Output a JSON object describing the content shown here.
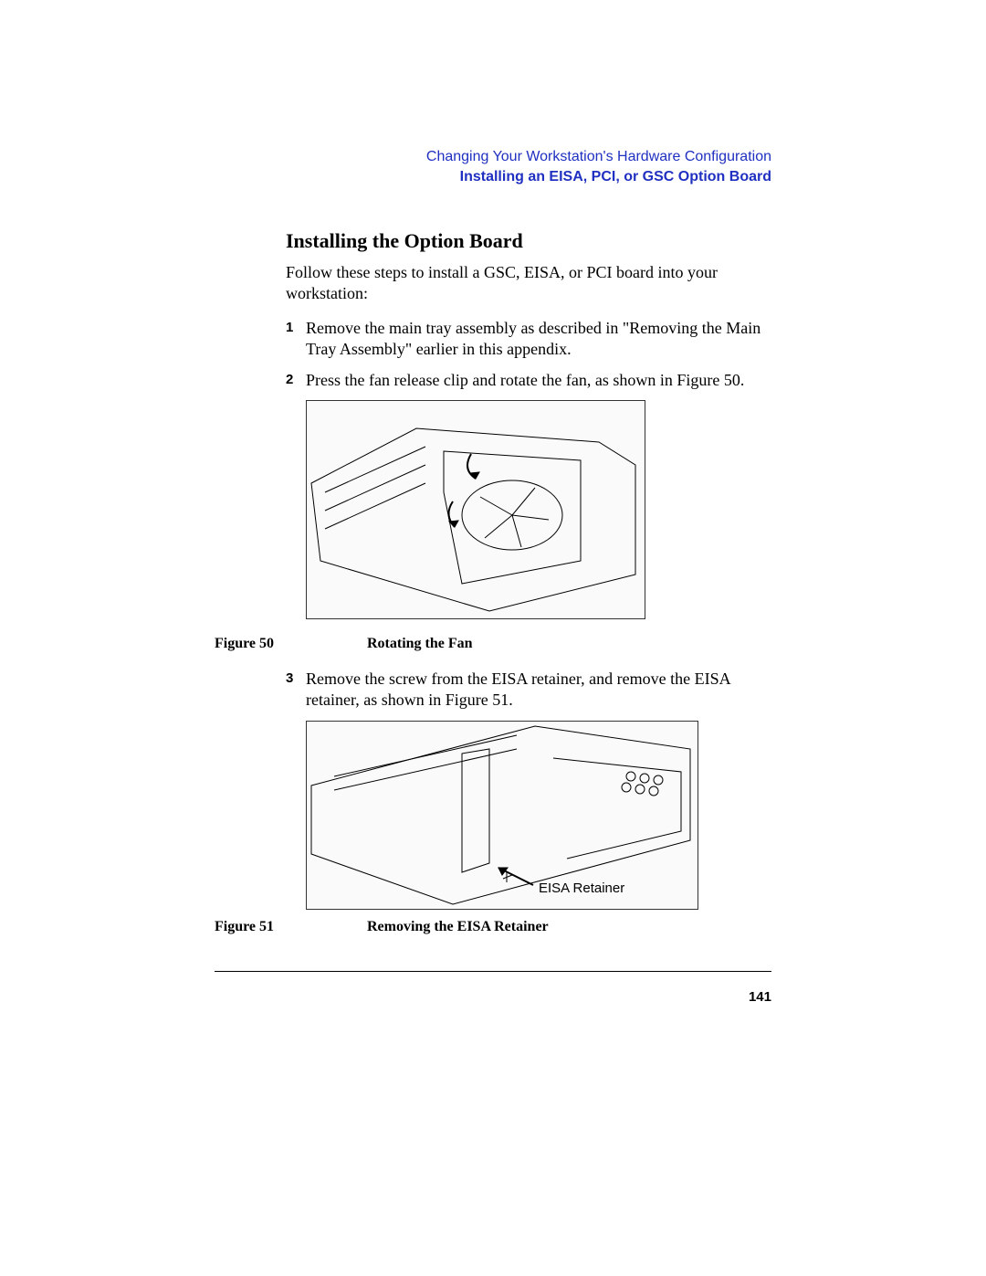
{
  "header": {
    "line1": "Changing Your Workstation's Hardware Configuration",
    "line2": "Installing an EISA, PCI, or GSC Option Board"
  },
  "section_title": "Installing the Option Board",
  "intro": "Follow these steps to install a GSC, EISA, or PCI board into your workstation:",
  "steps": [
    {
      "num": "1",
      "text": "Remove the main tray assembly as described in \"Removing the Main Tray Assembly\" earlier in this appendix."
    },
    {
      "num": "2",
      "text": "Press the fan release clip and rotate the fan, as shown in Figure 50."
    },
    {
      "num": "3",
      "text": "Remove the screw from the EISA retainer, and remove the EISA retainer, as shown in Figure 51."
    }
  ],
  "figures": [
    {
      "label": "Figure 50",
      "caption": "Rotating the Fan"
    },
    {
      "label": "Figure 51",
      "caption": "Removing the EISA Retainer"
    }
  ],
  "fig51_annotation": "EISA Retainer",
  "page_number": "141"
}
